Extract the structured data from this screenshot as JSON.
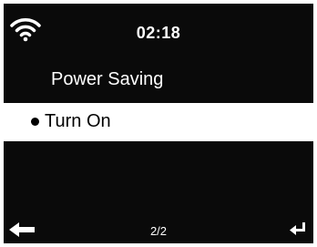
{
  "status": {
    "icon": "wifi-signal-icon",
    "time": "02:18"
  },
  "menu": {
    "title": "Power Saving",
    "options": [
      {
        "label": "Turn On",
        "selected": true
      }
    ]
  },
  "footer": {
    "back_icon": "back-arrow-icon",
    "page": "2/2",
    "enter_icon": "enter-return-icon"
  },
  "colors": {
    "screen_bg": "#0a0a0a",
    "text": "#ffffff",
    "highlight_bg": "#ffffff",
    "highlight_text": "#000000"
  }
}
